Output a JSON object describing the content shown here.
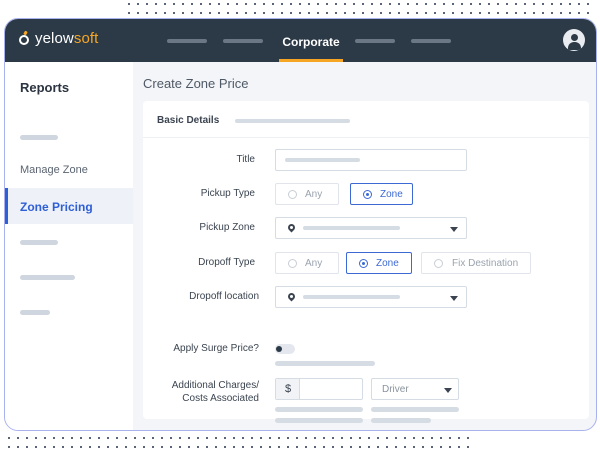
{
  "brand": {
    "name_part1": "yelow",
    "name_part2": "soft",
    "accent": "#f6a623",
    "topbar_color": "#2c3a47"
  },
  "header": {
    "active_tab": "Corporate",
    "profile_icon": "user-icon"
  },
  "sidebar": {
    "title": "Reports",
    "items": [
      {
        "label": "Manage Zone"
      },
      {
        "label": "Zone Pricing",
        "active": true
      }
    ],
    "active_color": "#2e5fd6"
  },
  "page": {
    "title": "Create Zone Price"
  },
  "form": {
    "section_title": "Basic Details",
    "title_label": "Title",
    "pickup_type_label": "Pickup Type",
    "pickup_type_options": [
      "Any",
      "Zone"
    ],
    "pickup_type_selected": "Zone",
    "pickup_zone_label": "Pickup Zone",
    "dropoff_type_label": "Dropoff Type",
    "dropoff_type_options": [
      "Any",
      "Zone",
      "Fix Destination"
    ],
    "dropoff_type_selected": "Zone",
    "dropoff_location_label": "Dropoff location",
    "surge_label": "Apply Surge Price?",
    "surge_enabled": false,
    "charges_label_line1": "Additional Charges/",
    "charges_label_line2": "Costs Associated",
    "currency_symbol": "$",
    "charge_type_value": "Driver"
  }
}
